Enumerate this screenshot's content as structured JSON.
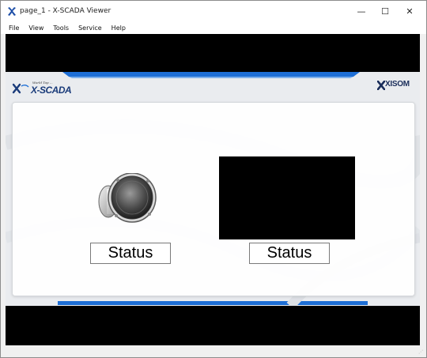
{
  "window": {
    "title": "page_1 - X-SCADA Viewer",
    "minimize_glyph": "—",
    "maximize_glyph": "☐",
    "close_glyph": "✕"
  },
  "menu": {
    "items": [
      "File",
      "View",
      "Tools",
      "Service",
      "Help"
    ]
  },
  "canvas": {
    "logo_left_tagline": "World Top ...",
    "logo_left_text": "X-SCADA",
    "logo_right_text": "XISOM",
    "status_left": "Status",
    "status_right": "Status"
  },
  "colors": {
    "accent_blue": "#1e6fd6",
    "logo_navy": "#1a3b7a"
  },
  "icons": [
    "app-icon",
    "speaker-icon",
    "xisom-logo-icon"
  ]
}
